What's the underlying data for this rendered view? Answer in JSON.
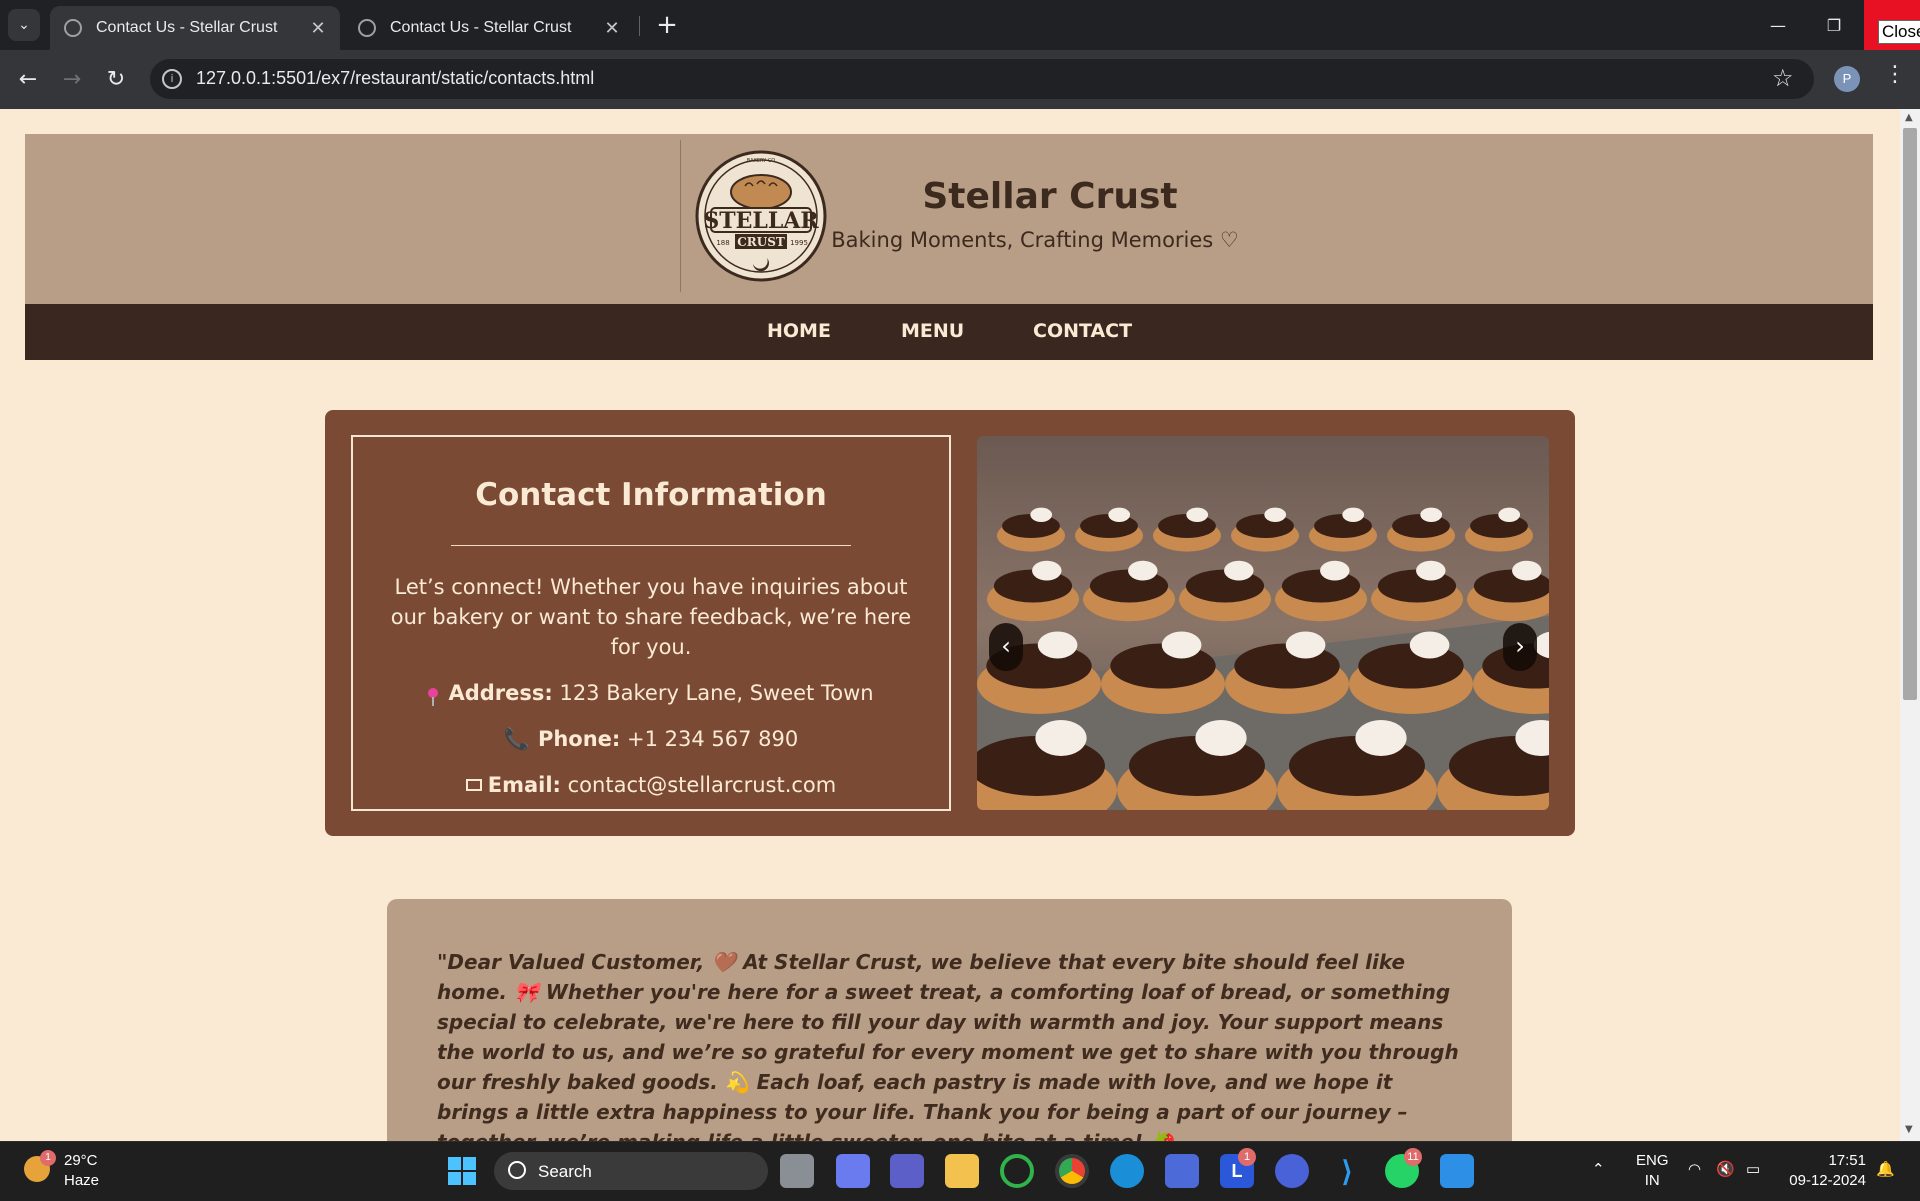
{
  "browser": {
    "tabs": [
      {
        "title": "Contact Us - Stellar Crust",
        "active": true
      },
      {
        "title": "Contact Us - Stellar Crust",
        "active": false
      }
    ],
    "new_tab_label": "+",
    "url": "127.0.0.1:5501/ex7/restaurant/static/contacts.html",
    "profile_initial": "P",
    "close_tooltip": "Close"
  },
  "header": {
    "title": "Stellar Crust",
    "tagline": "Baking Moments, Crafting Memories ♡",
    "logo_text": {
      "top": "BAKERY CO",
      "name_line1": "STELLAR",
      "name_line2": "CRUST",
      "left_year": "188",
      "right_year": "1995"
    }
  },
  "nav": {
    "items": [
      {
        "label": "HOME"
      },
      {
        "label": "MENU"
      },
      {
        "label": "CONTACT"
      }
    ]
  },
  "contact": {
    "heading": "Contact Information",
    "intro": "Let’s connect! Whether you have inquiries about our bakery or want to share feedback, we’re here for you.",
    "address_label": "Address:",
    "address_value": "123 Bakery Lane, Sweet Town",
    "phone_label": "Phone:",
    "phone_value": "+1 234 567 890",
    "email_label": "Email:",
    "email_value": "contact@stellarcrust.com"
  },
  "carousel": {
    "prev_label": "‹",
    "next_label": "›"
  },
  "letter": {
    "text": "\"Dear Valued Customer,  🤎  At Stellar Crust, we believe that every bite should feel like home. 🎀 Whether you're here for a sweet treat, a comforting loaf of bread, or something special to celebrate, we're here to fill your day with warmth and joy. Your support means the world to us, and we’re so grateful for every moment we get to share with you through our freshly baked goods. 💫 Each loaf, each pastry is made with love, and we hope it brings a little extra happiness to your life. Thank you for being a part of our journey – together, we’re making life a little sweeter, one bite at a time!  🍓"
  },
  "taskbar": {
    "weather_badge": "1",
    "temperature": "29°C",
    "condition": "Haze",
    "search_label": "Search",
    "apps": [
      {
        "name": "file-manager",
        "badge": ""
      },
      {
        "name": "copilot",
        "badge": ""
      },
      {
        "name": "teams",
        "badge": ""
      },
      {
        "name": "file-explorer",
        "badge": ""
      },
      {
        "name": "app-ring",
        "badge": ""
      },
      {
        "name": "chrome",
        "badge": ""
      },
      {
        "name": "edge",
        "badge": ""
      },
      {
        "name": "store",
        "badge": ""
      },
      {
        "name": "l-app",
        "badge": "1"
      },
      {
        "name": "arc-app",
        "badge": ""
      },
      {
        "name": "vscode",
        "badge": ""
      },
      {
        "name": "whatsapp",
        "badge": "11"
      },
      {
        "name": "photos",
        "badge": ""
      }
    ],
    "lang_line1": "ENG",
    "lang_line2": "IN",
    "time": "17:51",
    "date": "09-12-2024"
  },
  "colors": {
    "page_bg": "#faead4",
    "header_bg": "#b99e87",
    "nav_bg": "#3a2820",
    "card_bg": "#7b4a35",
    "close_red": "#e81123"
  }
}
